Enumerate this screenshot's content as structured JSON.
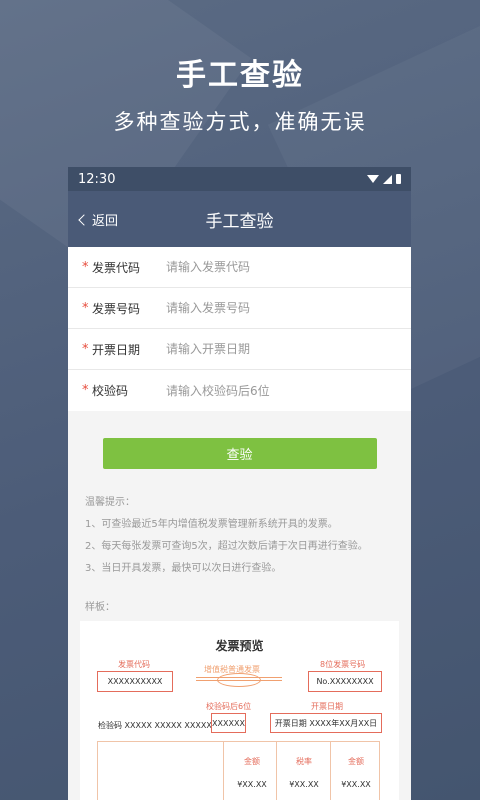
{
  "hero": {
    "title": "手工查验",
    "subtitle": "多种查验方式，准确无误"
  },
  "status_bar": {
    "time": "12:30"
  },
  "nav": {
    "back_label": "返回",
    "title": "手工查验"
  },
  "form": {
    "required_mark": "*",
    "fields": [
      {
        "label": "发票代码",
        "placeholder": "请输入发票代码"
      },
      {
        "label": "发票号码",
        "placeholder": "请输入发票号码"
      },
      {
        "label": "开票日期",
        "placeholder": "请输入开票日期"
      },
      {
        "label": "校验码",
        "placeholder": "请输入校验码后6位"
      }
    ],
    "submit_label": "查验"
  },
  "tips": {
    "heading": "温馨提示：",
    "items": [
      "1、可查验最近5年内增值税发票管理新系统开具的发票。",
      "2、每天每张发票可查询5次，超过次数后请于次日再进行查验。",
      "3、当日开具发票，最快可以次日进行查验。"
    ]
  },
  "sample": {
    "label": "样板：",
    "title": "发票预览",
    "invoice_code_label": "发票代码",
    "invoice_code_value": "XXXXXXXXXX",
    "stamp_text": "增值税普通发票",
    "invoice_number_label": "8位发票号码",
    "invoice_number_value": "No.XXXXXXXX",
    "check_code_hint": "校验码后6位",
    "check_code_line_prefix": "检验码 XXXXX XXXXX XXXXX",
    "check_code_highlight": "XXXXXX",
    "date_label": "开票日期",
    "date_value": "开票日期 XXXX年XX月XX日",
    "columns": [
      {
        "head": "金额",
        "value": "¥XX.XX"
      },
      {
        "head": "税率",
        "value": "¥XX.XX"
      },
      {
        "head": "金额",
        "value": "¥XX.XX"
      }
    ]
  },
  "colors": {
    "primary_button": "#7ec141",
    "nav_bar": "#4a5a77",
    "required": "#e74c3c",
    "highlight": "#e46c5b"
  }
}
